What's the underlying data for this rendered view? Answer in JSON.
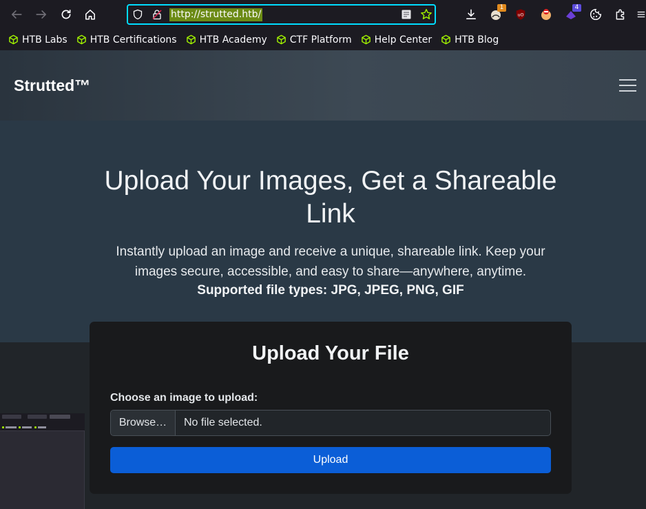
{
  "browser": {
    "url": "http://strutted.htb/",
    "icons": {
      "back": "arrow-left-icon",
      "forward": "arrow-right-icon",
      "reload": "reload-icon",
      "home": "home-icon",
      "shield": "shield-icon",
      "lock": "insecure-lock-icon",
      "reader": "reader-view-icon",
      "bookmark_star": "star-icon",
      "downloads": "download-icon",
      "extensions": "puzzle-icon",
      "menu": "hamburger-menu-icon"
    },
    "extension_badges": {
      "ext1": "1",
      "ext2": "4"
    },
    "accent": "#00ddff"
  },
  "bookmarks": [
    {
      "label": "HTB Labs"
    },
    {
      "label": "HTB Certifications"
    },
    {
      "label": "HTB Academy"
    },
    {
      "label": "CTF Platform"
    },
    {
      "label": "Help Center"
    },
    {
      "label": "HTB Blog"
    }
  ],
  "site": {
    "brand": "Strutted™",
    "hero": {
      "title": "Upload Your Images, Get a Shareable Link",
      "subtitle": "Instantly upload an image and receive a unique, shareable link. Keep your images secure, accessible, and easy to share—anywhere, anytime.",
      "supported": "Supported file types: JPG, JPEG, PNG, GIF"
    },
    "upload_card": {
      "title": "Upload Your File",
      "label": "Choose an image to upload:",
      "browse_label": "Browse…",
      "file_status": "No file selected.",
      "submit_label": "Upload"
    },
    "colors": {
      "primary_button": "#0b5ed7",
      "bookmark_icon": "#9fef00"
    }
  }
}
